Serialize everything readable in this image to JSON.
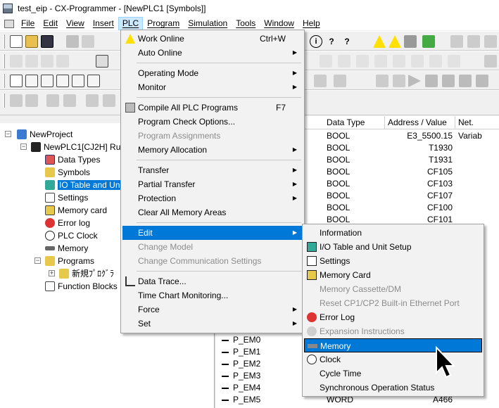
{
  "window": {
    "title": "test_eip - CX-Programmer - [NewPLC1 [Symbols]]"
  },
  "menubar": [
    "File",
    "Edit",
    "View",
    "Insert",
    "PLC",
    "Program",
    "Simulation",
    "Tools",
    "Window",
    "Help"
  ],
  "tree": {
    "project": "NewProject",
    "plc": "NewPLC1[CJ2H] Ru",
    "items": [
      "Data Types",
      "Symbols",
      "IO Table and Unit",
      "Settings",
      "Memory card",
      "Error log",
      "PLC Clock",
      "Memory",
      "Programs",
      "新規ﾌﾟﾛｸﾞﾗ",
      "Function Blocks"
    ]
  },
  "grid": {
    "headers": [
      "Data Type",
      "Address / Value",
      "Net. Variab"
    ],
    "rows": [
      {
        "name": "",
        "type": "BOOL",
        "addr": "E3_5500.15"
      },
      {
        "name": "",
        "type": "BOOL",
        "addr": "T1930"
      },
      {
        "name": "",
        "type": "BOOL",
        "addr": "T1931"
      },
      {
        "name": "",
        "type": "BOOL",
        "addr": "CF105"
      },
      {
        "name": "",
        "type": "BOOL",
        "addr": "CF103"
      },
      {
        "name": "",
        "type": "BOOL",
        "addr": "CF107"
      },
      {
        "name": "",
        "type": "BOOL",
        "addr": "CF100"
      },
      {
        "name": "",
        "type": "BOOL",
        "addr": "CF101"
      }
    ],
    "bottom_rows": [
      {
        "name": "P_EM0",
        "type": "",
        "addr": ""
      },
      {
        "name": "P_EM1",
        "type": "",
        "addr": ""
      },
      {
        "name": "P_EM2",
        "type": "",
        "addr": ""
      },
      {
        "name": "P_EM3",
        "type": "",
        "addr": ""
      },
      {
        "name": "P_EM4",
        "type": "",
        "addr": ""
      },
      {
        "name": "P_EM5",
        "type": "WORD",
        "addr": "A466"
      }
    ]
  },
  "plc_menu": {
    "work_online": "Work Online",
    "work_online_key": "Ctrl+W",
    "auto_online": "Auto Online",
    "operating_mode": "Operating Mode",
    "monitor": "Monitor",
    "compile_all": "Compile All PLC Programs",
    "compile_key": "F7",
    "program_check": "Program Check Options...",
    "program_assignments": "Program Assignments",
    "memory_allocation": "Memory Allocation",
    "transfer": "Transfer",
    "partial_transfer": "Partial Transfer",
    "protection": "Protection",
    "clear_all_memory": "Clear All Memory Areas",
    "edit": "Edit",
    "change_model": "Change Model",
    "change_comm": "Change Communication Settings",
    "data_trace": "Data Trace...",
    "time_chart": "Time Chart Monitoring...",
    "force": "Force",
    "set": "Set"
  },
  "edit_submenu": {
    "information": "Information",
    "io_table": "I/O Table and Unit Setup",
    "settings": "Settings",
    "memory_card": "Memory Card",
    "memory_cassette": "Memory Cassette/DM",
    "reset_ethernet": "Reset CP1/CP2 Built-in Ethernet Port",
    "error_log": "Error Log",
    "expansion": "Expansion Instructions",
    "memory": "Memory",
    "clock": "Clock",
    "cycle_time": "Cycle Time",
    "sync_status": "Synchronous Operation Status"
  },
  "colors": {
    "highlight": "#0078d7",
    "menu_bg": "#f2f2f2",
    "disabled": "#8c8c8c"
  }
}
